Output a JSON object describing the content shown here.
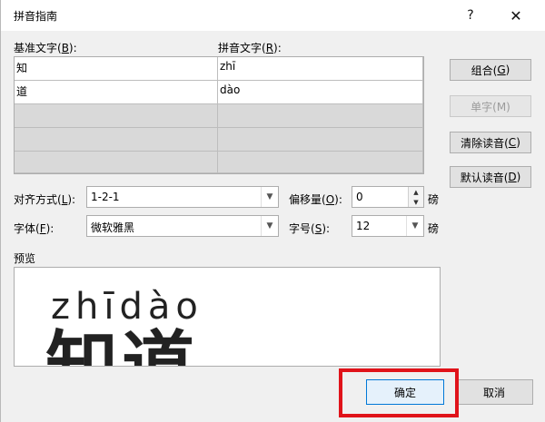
{
  "titlebar": {
    "title": "拼音指南",
    "help": "?",
    "close": "✕"
  },
  "labels": {
    "base_text": "基准文字(",
    "base_key": "B",
    "base_end": "):",
    "ruby_text": "拼音文字(",
    "ruby_key": "R",
    "ruby_end": "):",
    "align": "对齐方式(",
    "align_key": "L",
    "align_end": "):",
    "offset": "偏移量(",
    "offset_key": "O",
    "offset_end": "):",
    "font": "字体(",
    "font_key": "F",
    "font_end": "):",
    "size": "字号(",
    "size_key": "S",
    "size_end": "):",
    "unit1": "磅",
    "unit2": "磅",
    "preview": "预览"
  },
  "rows": [
    {
      "base": "知",
      "ruby": "zhī"
    },
    {
      "base": "道",
      "ruby": "dào"
    },
    {
      "base": "",
      "ruby": ""
    },
    {
      "base": "",
      "ruby": ""
    },
    {
      "base": "",
      "ruby": ""
    }
  ],
  "side_buttons": {
    "group": "组合(",
    "group_key": "G",
    "group_end": ")",
    "mono": "单字(M)",
    "clear": "清除读音(",
    "clear_key": "C",
    "clear_end": ")",
    "default": "默认读音(",
    "default_key": "D",
    "default_end": ")"
  },
  "fields": {
    "align_value": "1-2-1",
    "offset_value": "0",
    "font_value": "微软雅黑",
    "size_value": "12"
  },
  "preview": {
    "pinyin": "zhīdào",
    "hanzi": "知道"
  },
  "buttons": {
    "ok": "确定",
    "cancel": "取消"
  },
  "colors": {
    "highlight": "#e0131a",
    "ok_border": "#0078d7"
  }
}
